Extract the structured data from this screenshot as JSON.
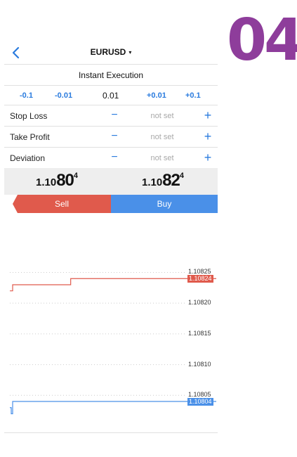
{
  "badge": {
    "text": "04",
    "color": "#8e3d9b"
  },
  "header": {
    "symbol": "EURUSD",
    "caret": "▾",
    "back_icon": "chevron-left-icon"
  },
  "execution": {
    "mode": "Instant Execution"
  },
  "volume": {
    "decrease_large": "-0.1",
    "decrease_small": "-0.01",
    "current": "0.01",
    "increase_small": "+0.01",
    "increase_large": "+0.1"
  },
  "params": [
    {
      "label": "Stop Loss",
      "minus": "−",
      "value": "not set",
      "plus": "+"
    },
    {
      "label": "Take Profit",
      "minus": "−",
      "value": "not set",
      "plus": "+"
    },
    {
      "label": "Deviation",
      "minus": "−",
      "value": "not set",
      "plus": "+"
    }
  ],
  "quotes": {
    "bid": {
      "prefix": "1.10",
      "main": "80",
      "pip": "4"
    },
    "ask": {
      "prefix": "1.10",
      "main": "82",
      "pip": "4"
    }
  },
  "actions": {
    "sell": "Sell",
    "buy": "Buy"
  },
  "colors": {
    "accent": "#2a7bde",
    "sell": "#e05a4c",
    "buy": "#4a90e8"
  },
  "chart_data": {
    "type": "line",
    "ylim": [
      1.108,
      1.10827
    ],
    "ticks": [
      "1.10825",
      "1.10820",
      "1.10815",
      "1.10810",
      "1.10805"
    ],
    "tick_values": [
      1.10825,
      1.1082,
      1.10815,
      1.1081,
      1.10805
    ],
    "series": [
      {
        "values": [
          1.10822,
          1.10822,
          1.10823,
          1.10824,
          1.10824,
          1.10824
        ],
        "color": "#e05a4c"
      },
      {
        "values": [
          1.10803,
          1.10802,
          1.10804,
          1.10804,
          1.10804,
          1.10804
        ],
        "color": "#4a90e8"
      }
    ],
    "bid_tag": "1.10824",
    "ask_tag": "1.10804"
  }
}
